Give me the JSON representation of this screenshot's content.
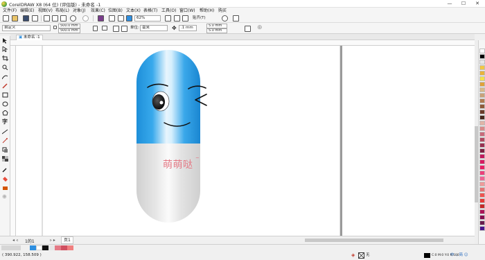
{
  "titlebar": {
    "title": "CorelDRAW X8 (64 位) (评估版) - 未命名 -1",
    "minimize": "—",
    "maximize": "☐",
    "close": "✕"
  },
  "menu": [
    "文件(F)",
    "编辑(E)",
    "视图(V)",
    "布局(L)",
    "对象(J)",
    "效果(C)",
    "位图(B)",
    "文本(X)",
    "表格(T)",
    "工具(O)",
    "窗口(W)",
    "帮助(H)",
    "购买"
  ],
  "toolbar": {
    "zoom_value": "62%",
    "snap_label": "贴齐(T)"
  },
  "propbar": {
    "page_size": "自定义",
    "width": "500.0 mm",
    "height": "500.0 mm",
    "units_label": "单位:",
    "units_value": "毫米",
    "nudge": ".1 mm",
    "dup_x": "5.0 mm",
    "dup_y": "5.0 mm"
  },
  "tabs": {
    "doc_tab": "未命名 -1"
  },
  "canvas": {
    "pill_text": "萌萌哒",
    "pill_mark": "~"
  },
  "pagebar": {
    "page_counter": "1的1",
    "page_tab": "页1"
  },
  "statusbar": {
    "coords": "( 390.922, 158.509 )",
    "fill_none": "无",
    "color_info": "C:0 M:0 Y:0 K:100",
    "ime": "中 ·, 简 ☺"
  },
  "colors": {
    "pill_blue": "#1f9de3",
    "pill_gray": "#dadada",
    "text_pink": "#e47a86",
    "accent_blue": "#2f8fe0"
  },
  "icons": [
    "pick-tool-icon",
    "shape-tool-icon",
    "crop-tool-icon",
    "zoom-tool-icon",
    "freehand-tool-icon",
    "artistic-media-icon",
    "rectangle-tool-icon",
    "ellipse-tool-icon",
    "polygon-tool-icon",
    "text-tool-icon",
    "parallel-dimension-icon",
    "connector-icon",
    "drop-shadow-icon",
    "transparency-icon",
    "eyedropper-icon",
    "interactive-fill-icon",
    "smart-fill-icon"
  ]
}
